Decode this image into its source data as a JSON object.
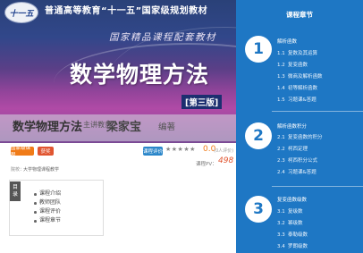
{
  "cover": {
    "logo_text": "十一五",
    "series_title": "普通高等教育“十一五”国家级规划教材",
    "subtitle": "国家精品课程配套教材",
    "book_title": "数学物理方法",
    "edition": "[第三版]",
    "overlay_title": "数学物理方法",
    "overlay_author_label": "主讲教师：",
    "overlay_author": "梁家宝",
    "overlay_role": "编著"
  },
  "info": {
    "tag1": "国家级课程",
    "tag2": "获奖",
    "tag3": "课程评价",
    "stars": "★★★★★",
    "score": "0.0",
    "score_detail": "(0人评价)",
    "pv_label": "课程PV：",
    "pv_value": "498",
    "publisher_label": "院校：",
    "publisher": "大学物理课程教学"
  },
  "directory": {
    "label_line1": "目",
    "label_line2": "录",
    "items": [
      "课程介绍",
      "教师团队",
      "课程评价",
      "课程章节"
    ]
  },
  "chapters_panel": {
    "header": "课程章节",
    "chapters": [
      {
        "number": "1",
        "name": "解析函数",
        "sections": [
          {
            "num": "1.1",
            "title": "复数及其运算"
          },
          {
            "num": "1.2",
            "title": "复变函数"
          },
          {
            "num": "1.3",
            "title": "微商及解析函数"
          },
          {
            "num": "1.4",
            "title": "初等解析函数"
          },
          {
            "num": "1.5",
            "title": "习题课&答题"
          }
        ]
      },
      {
        "number": "2",
        "name": "解析函数积分",
        "sections": [
          {
            "num": "2.1",
            "title": "复变函数的积分"
          },
          {
            "num": "2.2",
            "title": "柯西定理"
          },
          {
            "num": "2.3",
            "title": "柯西积分公式"
          },
          {
            "num": "2.4",
            "title": "习题课&答题"
          }
        ]
      },
      {
        "number": "3",
        "name": "复变函数级数",
        "sections": [
          {
            "num": "3.1",
            "title": "复级数"
          },
          {
            "num": "3.2",
            "title": "幂级数"
          },
          {
            "num": "3.3",
            "title": "泰勒级数"
          },
          {
            "num": "3.4",
            "title": "罗朗级数"
          }
        ]
      }
    ]
  }
}
